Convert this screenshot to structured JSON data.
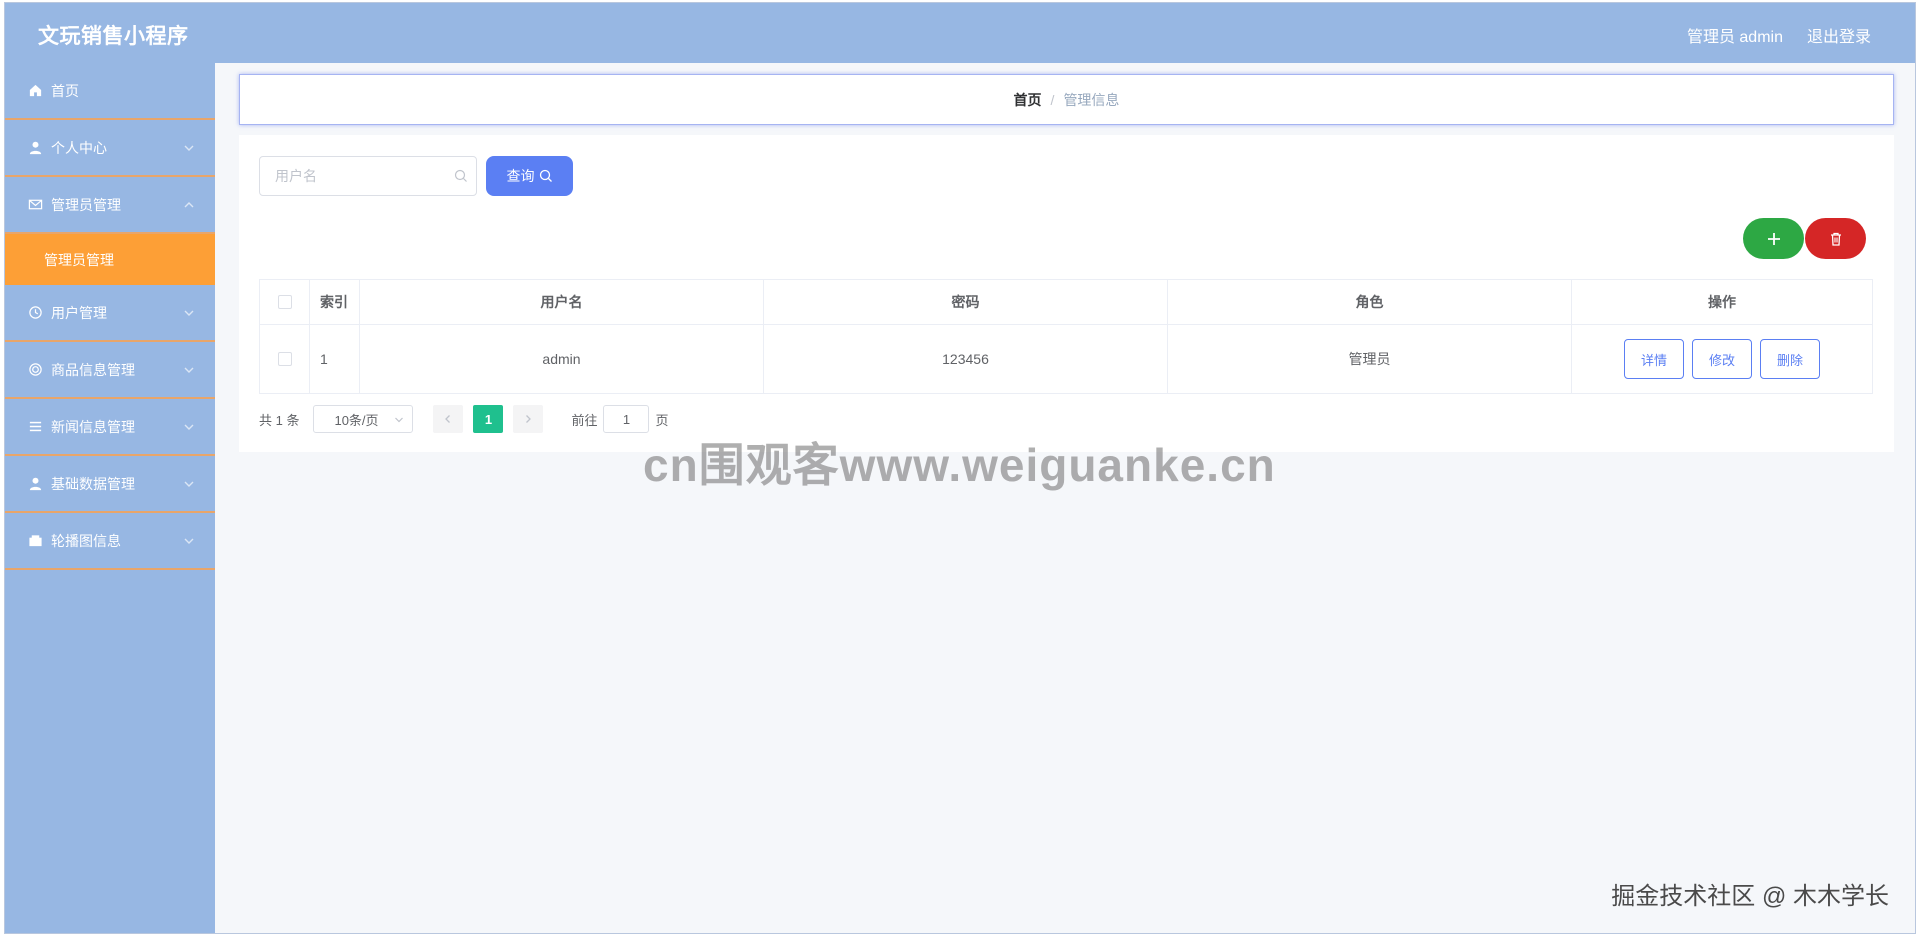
{
  "app": {
    "title": "文玩销售小程序"
  },
  "header": {
    "user_label": "管理员 admin",
    "logout_label": "退出登录"
  },
  "sidebar": {
    "items": [
      {
        "label": "首页",
        "icon": "home-icon"
      },
      {
        "label": "个人中心",
        "icon": "user-icon"
      },
      {
        "label": "管理员管理",
        "icon": "mail-icon"
      },
      {
        "label": "用户管理",
        "icon": "clock-icon"
      },
      {
        "label": "商品信息管理",
        "icon": "target-icon"
      },
      {
        "label": "新闻信息管理",
        "icon": "list-icon"
      },
      {
        "label": "基础数据管理",
        "icon": "user-icon"
      },
      {
        "label": "轮播图信息",
        "icon": "wallet-icon"
      }
    ],
    "active_sub": "管理员管理"
  },
  "breadcrumb": {
    "home": "首页",
    "separator": "/",
    "current": "管理信息"
  },
  "search": {
    "placeholder": "用户名",
    "button_label": "查询"
  },
  "table": {
    "headers": [
      "索引",
      "用户名",
      "密码",
      "角色",
      "操作"
    ],
    "rows": [
      {
        "index": "1",
        "username": "admin",
        "password": "123456",
        "role": "管理员"
      }
    ],
    "actions": [
      "详情",
      "修改",
      "删除"
    ]
  },
  "pagination": {
    "total": "共 1 条",
    "page_size": "10条/页",
    "current_page": "1",
    "goto_label": "前往",
    "goto_value": "1",
    "page_unit": "页"
  },
  "overlays": {
    "watermark": "cn围观客www.weiguanke.cn",
    "corner_mark": "掘金技术社区 @ 木木学长"
  },
  "colors": {
    "header_bg": "#97b7e3",
    "active_menu": "#fd9f36",
    "primary": "#5b7ff3",
    "add": "#2da844",
    "delete": "#d52626",
    "page_active": "#1fc08e"
  }
}
